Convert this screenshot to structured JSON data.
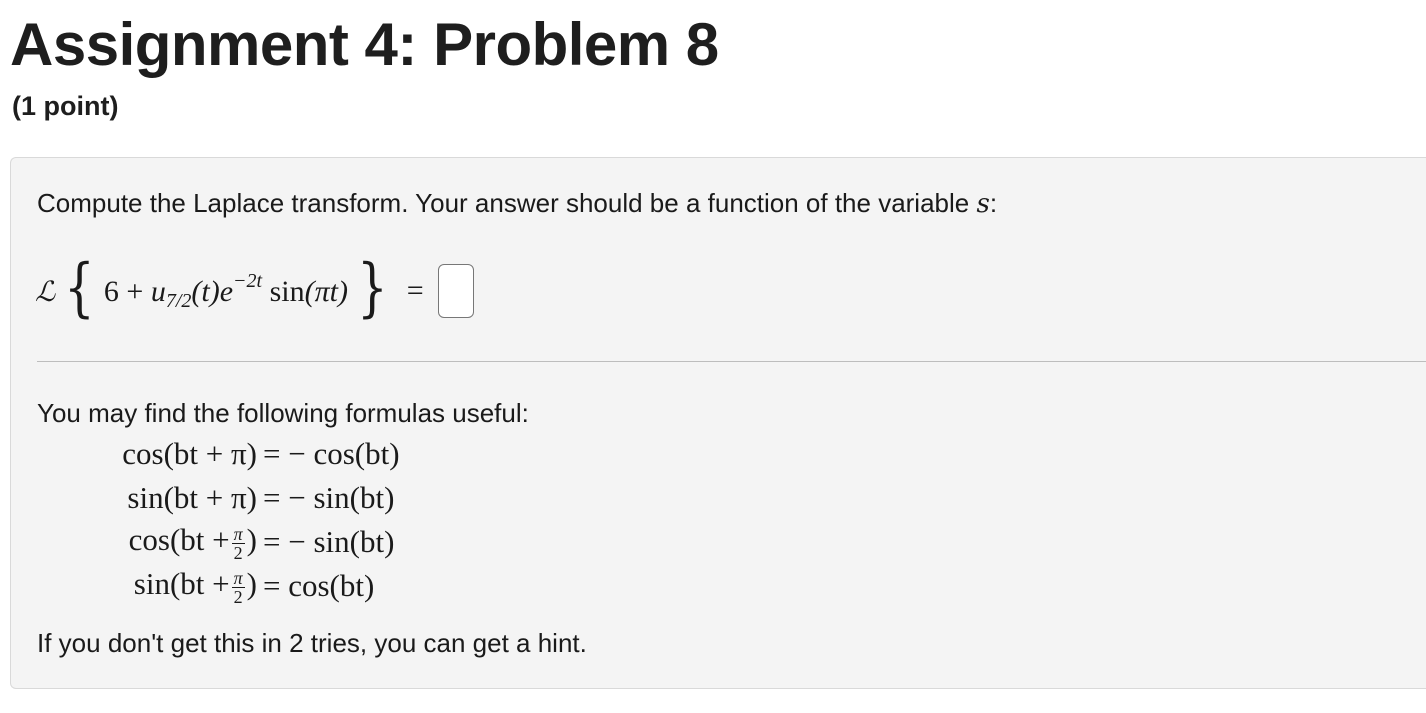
{
  "page": {
    "title": "Assignment 4: Problem 8",
    "points": "(1 point)"
  },
  "problem": {
    "prompt": "Compute the Laplace transform. Your answer should be a function of the variable",
    "variable": "s",
    "prompt_end": ":",
    "equation": {
      "operator": "ℒ",
      "constant": "6",
      "plus": "+",
      "step_fn": "u",
      "step_sub": "7/2",
      "step_arg": "(t)",
      "exp_base": "e",
      "exp_power": "−2t",
      "trig": "sin",
      "trig_arg": "(πt)",
      "equals": "="
    },
    "answer_value": ""
  },
  "formulas": {
    "label": "You may find the following formulas useful:",
    "rows": [
      {
        "lhs": "cos(bt + π)",
        "rhs": "= − cos(bt)"
      },
      {
        "lhs": "sin(bt + π)",
        "rhs": "= − sin(bt)"
      },
      {
        "lhs_func": "cos(bt +",
        "lhs_num": "π",
        "lhs_den": "2",
        "lhs_close": ")",
        "rhs": "= − sin(bt)"
      },
      {
        "lhs_func": "sin(bt +",
        "lhs_num": "π",
        "lhs_den": "2",
        "lhs_close": ")",
        "rhs": "= cos(bt)"
      }
    ]
  },
  "hint": {
    "text": "If you don't get this in 2 tries, you can get a hint."
  }
}
